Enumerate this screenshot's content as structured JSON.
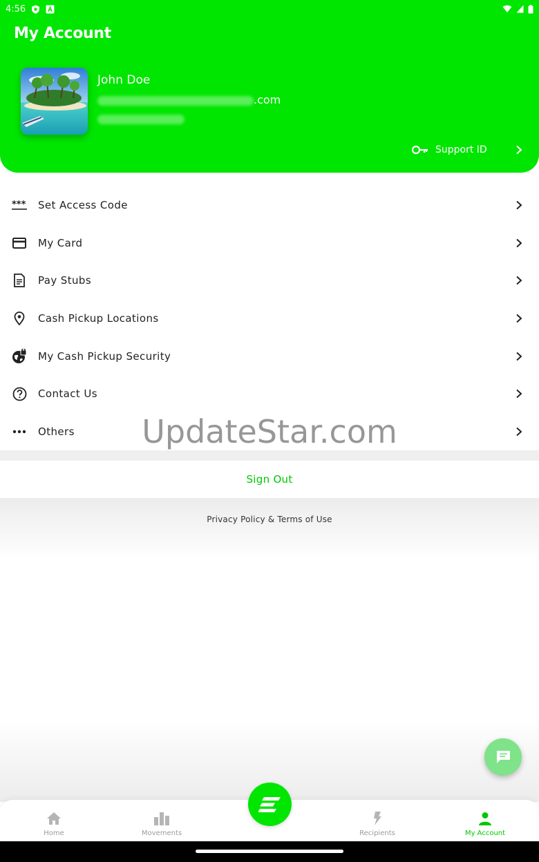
{
  "status_bar": {
    "time": "4:56"
  },
  "header": {
    "title": "My Account",
    "user_name": "John Doe",
    "email_suffix": ".com",
    "support_label": "Support ID"
  },
  "menu": {
    "items": [
      {
        "label": "Set Access Code",
        "icon": "asterisks-icon"
      },
      {
        "label": "My Card",
        "icon": "credit-card-icon"
      },
      {
        "label": "Pay Stubs",
        "icon": "document-icon"
      },
      {
        "label": "Cash Pickup Locations",
        "icon": "location-pin-icon"
      },
      {
        "label": "My Cash Pickup Security",
        "icon": "globe-lock-icon"
      },
      {
        "label": "Contact Us",
        "icon": "help-circle-icon"
      },
      {
        "label": "Others",
        "icon": "more-dots-icon"
      }
    ]
  },
  "sign_out_label": "Sign Out",
  "privacy_label": "Privacy Policy & Terms of Use",
  "watermark": "UpdateStar.com",
  "bottom_nav": {
    "items": [
      {
        "label": "Home",
        "icon": "home-icon"
      },
      {
        "label": "Movements",
        "icon": "bar-chart-icon"
      },
      {
        "label": "Recipients",
        "icon": "bolt-icon"
      },
      {
        "label": "My Account",
        "icon": "person-icon"
      }
    ],
    "active": "My Account"
  },
  "colors": {
    "brand_green": "#00e600",
    "accent_green": "#00c800",
    "fab_green": "#7ee389"
  }
}
